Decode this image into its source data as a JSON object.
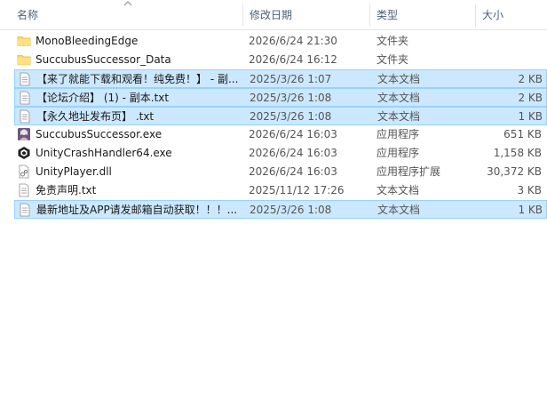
{
  "columns": {
    "name": "名称",
    "date": "修改日期",
    "type": "类型",
    "size": "大小"
  },
  "files": [
    {
      "name": "MonoBleedingEdge",
      "date": "2026/6/24 21:30",
      "type": "文件夹",
      "size": "",
      "icon": "folder-icon",
      "selected": false
    },
    {
      "name": "SuccubusSuccessor_Data",
      "date": "2026/6/24 16:12",
      "type": "文件夹",
      "size": "",
      "icon": "folder-icon",
      "selected": false
    },
    {
      "name": "【来了就能下载和观看！纯免费！】 - 副...",
      "date": "2025/3/26 1:07",
      "type": "文本文档",
      "size": "2 KB",
      "icon": "text-file-icon",
      "selected": true
    },
    {
      "name": "【论坛介绍】 (1) - 副本.txt",
      "date": "2025/3/26 1:08",
      "type": "文本文档",
      "size": "2 KB",
      "icon": "text-file-icon",
      "selected": true
    },
    {
      "name": "【永久地址发布页】 .txt",
      "date": "2025/3/26 1:08",
      "type": "文本文档",
      "size": "1 KB",
      "icon": "text-file-icon",
      "selected": true
    },
    {
      "name": "SuccubusSuccessor.exe",
      "date": "2026/6/24 16:03",
      "type": "应用程序",
      "size": "651 KB",
      "icon": "app-icon",
      "selected": false
    },
    {
      "name": "UnityCrashHandler64.exe",
      "date": "2026/6/24 16:03",
      "type": "应用程序",
      "size": "1,158 KB",
      "icon": "unity-icon",
      "selected": false
    },
    {
      "name": "UnityPlayer.dll",
      "date": "2026/6/24 16:03",
      "type": "应用程序扩展",
      "size": "30,372 KB",
      "icon": "dll-file-icon",
      "selected": false
    },
    {
      "name": "免责声明.txt",
      "date": "2025/11/12 17:26",
      "type": "文本文档",
      "size": "3 KB",
      "icon": "text-file-icon",
      "selected": false
    },
    {
      "name": "最新地址及APP请发邮箱自动获取！！！...",
      "date": "2025/3/26 1:08",
      "type": "文本文档",
      "size": "1 KB",
      "icon": "text-file-icon",
      "selected": true
    }
  ],
  "colors": {
    "selection": "#cce8ff",
    "selection_border": "#99d1ff",
    "folder": "#ffd86b",
    "header_text": "#4c607a"
  }
}
